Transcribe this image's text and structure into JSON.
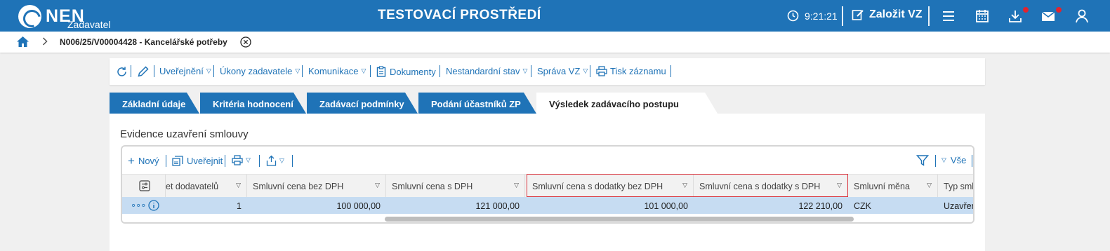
{
  "header": {
    "logo_text": "NEN",
    "logo_sub": "Zadavatel",
    "env_title": "TESTOVACÍ PROSTŘEDÍ",
    "clock": "9:21:21",
    "create_label": "Založit VZ",
    "icons": [
      "clock-icon",
      "edit-icon",
      "menu-icon",
      "calendar-icon",
      "download-icon",
      "mail-icon",
      "user-icon"
    ],
    "accent_color": "#1f73b7",
    "badge_color": "#e0242f"
  },
  "breadcrumb": {
    "current": "N006/25/V00004428 - Kancelářské potřeby"
  },
  "toolbar": {
    "items": [
      {
        "label": "Uveřejnění"
      },
      {
        "label": "Úkony zadavatele"
      },
      {
        "label": "Komunikace"
      },
      {
        "label": "Dokumenty"
      },
      {
        "label": "Nestandardní stav"
      },
      {
        "label": "Správa VZ"
      },
      {
        "label": "Tisk záznamu"
      }
    ]
  },
  "tabs": [
    {
      "label": "Základní údaje"
    },
    {
      "label": "Kritéria hodnocení"
    },
    {
      "label": "Zadávací podmínky"
    },
    {
      "label": "Podání účastníků ZP"
    },
    {
      "label": "Výsledek zadávacího postupu",
      "active": true
    }
  ],
  "section": {
    "title": "Evidence uzavření smlouvy"
  },
  "grid": {
    "toolbar": {
      "new_label": "Nový",
      "publish_label": "Uveřejnit",
      "all_label": "Vše"
    },
    "columns": [
      "et dodavatelů",
      "Smluvní cena bez DPH",
      "Smluvní cena s DPH",
      "Smluvní cena s dodatky bez DPH",
      "Smluvní cena s dodatky s DPH",
      "Smluvní měna",
      "Typ sml"
    ],
    "rows": [
      {
        "count": "1",
        "price_no_vat": "100 000,00",
        "price_vat": "121 000,00",
        "price_amend_no_vat": "101 000,00",
        "price_amend_vat": "122 210,00",
        "currency": "CZK",
        "type": "Uzavřen"
      }
    ],
    "highlight_color": "#d9333c",
    "row_selected_color": "#c6dcf2"
  }
}
